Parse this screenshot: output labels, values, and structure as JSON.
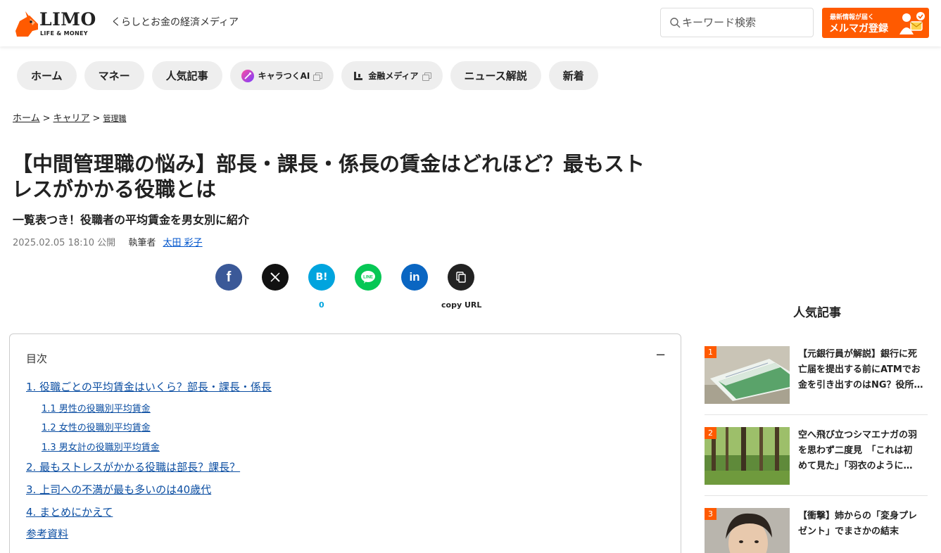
{
  "header": {
    "logo_word": "LIMO",
    "logo_sub": "LIFE & MONEY",
    "tagline": "くらしとお金の経済メディア",
    "search_placeholder": "キーワード検索",
    "mailmag_small": "最新情報が届く",
    "mailmag_label": "メルマガ登録",
    "brand_color": "#ff5a00"
  },
  "nav": {
    "items": [
      {
        "label": "ホーム"
      },
      {
        "label": "マネー"
      },
      {
        "label": "人気記事"
      },
      {
        "label": "キャラつくAI",
        "icon": "chara-ai-icon",
        "external": true
      },
      {
        "label": "金融メディア",
        "icon": "finance-media-icon",
        "external": true
      },
      {
        "label": "ニュース解説"
      },
      {
        "label": "新着"
      }
    ]
  },
  "breadcrumb": {
    "items": [
      "ホーム",
      "キャリア",
      "管理職"
    ],
    "separator": ">"
  },
  "article": {
    "title_line1": "【中間管理職の悩み】部長・課長・係長の賃金はどれほど？最もスト",
    "title_line2": "レスがかかる役職とは",
    "subtitle": "一覧表つき！役職者の平均賃金を男女別に紹介",
    "date": "2025.02.05 18:10 公開",
    "author_label": "執筆者",
    "author": "太田 彩子"
  },
  "share": {
    "facebook_icon": "facebook-icon",
    "x_icon": "x-icon",
    "hatena_label": "B!",
    "hatena_count": "0",
    "line_label": "LINE",
    "linkedin_label": "in",
    "copy_label": "copy URL"
  },
  "toc": {
    "title": "目次",
    "toggle": "−",
    "items": [
      "1. 役職ごとの平均賃金はいくら？部長・課長・係長",
      "1.1 男性の役職別平均賃金",
      "1.2 女性の役職別平均賃金",
      "1.3 男女計の役職別平均賃金",
      "2. 最もストレスがかかる役職は部長？課長？",
      "3. 上司への不満が最も多いのは40歳代",
      "4. まとめにかえて",
      "参考資料"
    ]
  },
  "popular": {
    "heading": "人気記事",
    "items": [
      {
        "rank": "1",
        "line1": "【元銀行員が解説】銀行に死",
        "line2": "亡届を提出する前にATMでお",
        "line3": "金を引き出すのはNG？役所…"
      },
      {
        "rank": "2",
        "line1": "空へ飛び立つシマエナガの羽",
        "line2": "を思わず二度見　「これは初",
        "line3": "めて見た」「羽衣のように…"
      },
      {
        "rank": "3",
        "line1": "【衝撃】姉からの「変身プレ",
        "line2": "ゼント」でまさかの結末",
        "line3": ""
      }
    ]
  }
}
